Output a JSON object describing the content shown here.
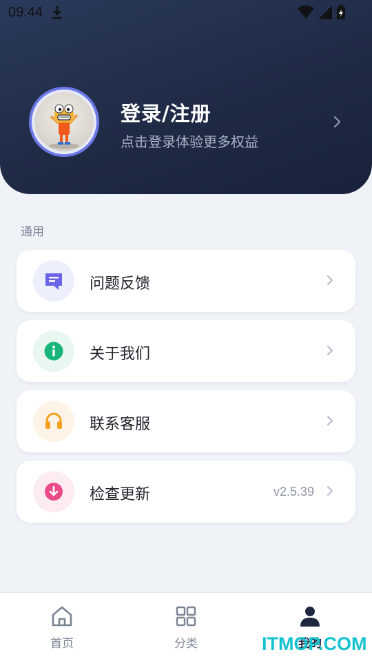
{
  "status_bar": {
    "time": "09:44",
    "icons": [
      "download-icon",
      "wifi-icon",
      "signal-icon",
      "battery-icon"
    ]
  },
  "profile": {
    "title": "登录/注册",
    "subtitle": "点击登录体验更多权益",
    "avatar_icon": "avatar"
  },
  "section": {
    "label": "通用"
  },
  "menu": [
    {
      "label": "问题反馈",
      "icon": "feedback-icon",
      "icon_color": "#6a64e6",
      "icon_bg": "#edeffc"
    },
    {
      "label": "关于我们",
      "icon": "info-icon",
      "icon_color": "#18b57a",
      "icon_bg": "#e8f7f0"
    },
    {
      "label": "联系客服",
      "icon": "headset-icon",
      "icon_color": "#f6a01e",
      "icon_bg": "#fdf3e6"
    },
    {
      "label": "检查更新",
      "icon": "download-circle-icon",
      "icon_color": "#ea4c8a",
      "icon_bg": "#fdebf2",
      "value": "v2.5.39"
    }
  ],
  "tabs": [
    {
      "label": "首页",
      "icon": "home-icon",
      "active": false
    },
    {
      "label": "分类",
      "icon": "grid-icon",
      "active": false
    },
    {
      "label": "我的",
      "icon": "user-icon",
      "active": true
    }
  ],
  "watermark": "ITMOP.COM",
  "colors": {
    "header": "#1f2a45",
    "accent_ring": "#6b78e6",
    "page_bg": "#eff2f7",
    "watermark": "#14c3cf"
  }
}
